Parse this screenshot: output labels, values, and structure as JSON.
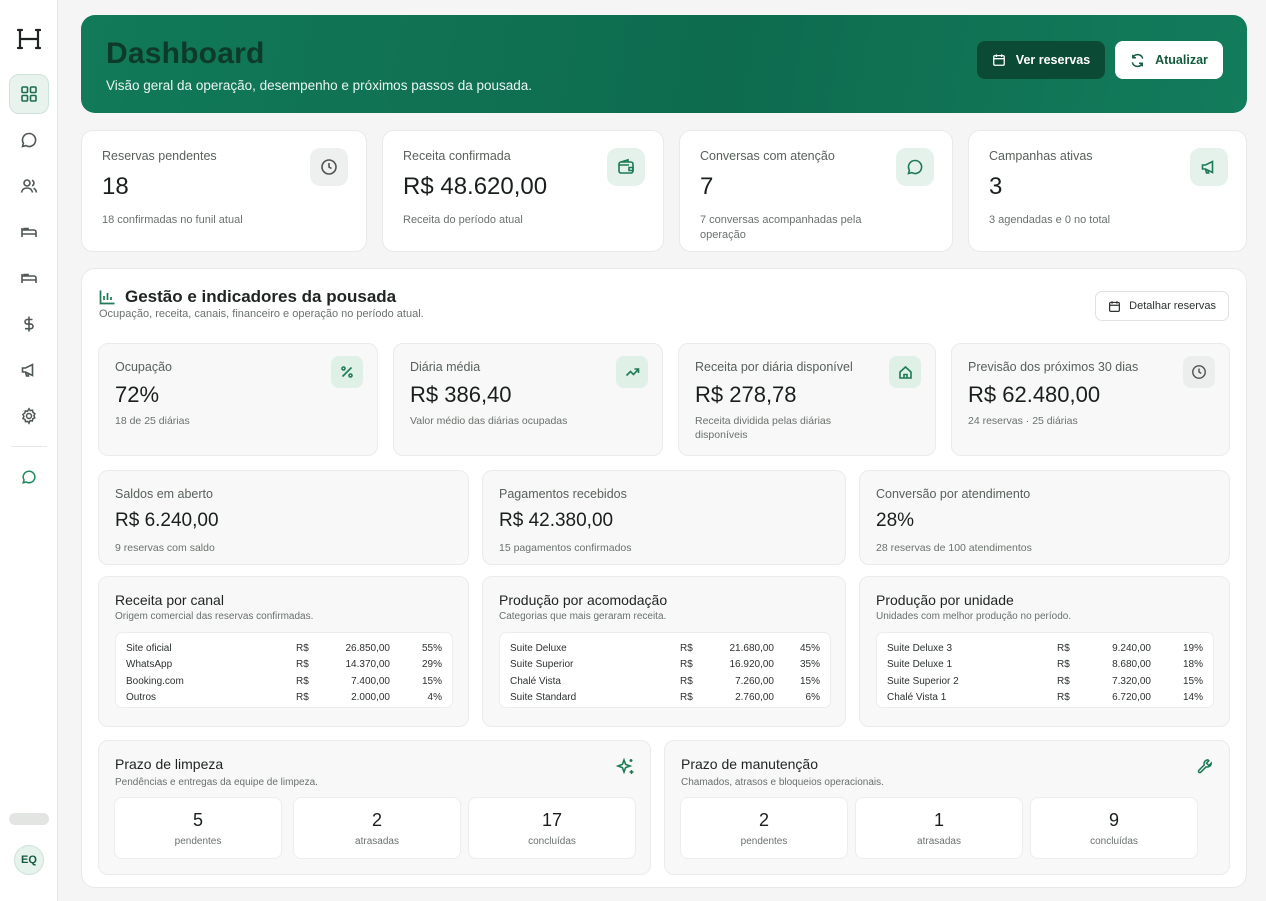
{
  "sidebar": {
    "logo": "H-logo",
    "items": [
      {
        "icon": "grid-icon",
        "active": true
      },
      {
        "icon": "chat-bubble-icon"
      },
      {
        "icon": "users-icon"
      },
      {
        "icon": "bed-icon"
      },
      {
        "icon": "bed-icon"
      },
      {
        "icon": "dollar-icon"
      },
      {
        "icon": "megaphone-icon"
      },
      {
        "icon": "gear-icon"
      },
      {
        "icon": "chat-bubble-icon"
      }
    ],
    "avatar_initials": "EQ"
  },
  "header": {
    "title": "Dashboard",
    "subtitle": "Visão geral da operação, desempenho e próximos passos da pousada.",
    "btn_reservations": "Ver reservas",
    "btn_refresh": "Atualizar"
  },
  "kpis": [
    {
      "label": "Reservas pendentes",
      "value": "18",
      "note": "18 confirmadas no funil atual",
      "icon": "clock-icon"
    },
    {
      "label": "Receita confirmada",
      "value": "R$ 48.620,00",
      "note": "Receita do período atual",
      "icon": "wallet-icon"
    },
    {
      "label": "Conversas com atenção",
      "value": "7",
      "note": "7 conversas acompanhadas pela operação",
      "icon": "chat-bubble-icon"
    },
    {
      "label": "Campanhas ativas",
      "value": "3",
      "note": "3 agendadas e 0 no total",
      "icon": "megaphone-icon"
    }
  ],
  "panel": {
    "title": "Gestão e indicadores da pousada",
    "subtitle": "Ocupação, receita, canais, financeiro e operação no período atual.",
    "btn_details": "Detalhar reservas"
  },
  "metrics": [
    {
      "label": "Ocupação",
      "value": "72%",
      "note": "18 de 25 diárias",
      "icon": "percent-icon"
    },
    {
      "label": "Diária média",
      "value": "R$ 386,40",
      "note": "Valor médio das diárias ocupadas",
      "icon": "trend-up-icon"
    },
    {
      "label": "Receita por diária disponível",
      "value": "R$ 278,78",
      "note": "Receita dividida pelas diárias disponíveis",
      "icon": "home-icon"
    },
    {
      "label": "Previsão dos próximos 30 dias",
      "value": "R$ 62.480,00",
      "note": "24 reservas · 25 diárias",
      "icon": "clock-icon"
    }
  ],
  "finance": [
    {
      "label": "Saldos em aberto",
      "value": "R$ 6.240,00",
      "note": "9 reservas com saldo"
    },
    {
      "label": "Pagamentos recebidos",
      "value": "R$ 42.380,00",
      "note": "15 pagamentos confirmados"
    },
    {
      "label": "Conversão por atendimento",
      "value": "28%",
      "note": "28 reservas de 100 atendimentos"
    }
  ],
  "tables": [
    {
      "title": "Receita por canal",
      "subtitle": "Origem comercial das reservas confirmadas.",
      "rows": [
        {
          "name": "Site oficial",
          "cur": "R$",
          "value": "26.850,00",
          "pct": "55%"
        },
        {
          "name": "WhatsApp",
          "cur": "R$",
          "value": "14.370,00",
          "pct": "29%"
        },
        {
          "name": "Booking.com",
          "cur": "R$",
          "value": "7.400,00",
          "pct": "15%"
        },
        {
          "name": "Outros",
          "cur": "R$",
          "value": "2.000,00",
          "pct": "4%"
        }
      ]
    },
    {
      "title": "Produção por acomodação",
      "subtitle": "Categorias que mais geraram receita.",
      "rows": [
        {
          "name": "Suite Deluxe",
          "cur": "R$",
          "value": "21.680,00",
          "pct": "45%"
        },
        {
          "name": "Suite Superior",
          "cur": "R$",
          "value": "16.920,00",
          "pct": "35%"
        },
        {
          "name": "Chalé Vista",
          "cur": "R$",
          "value": "7.260,00",
          "pct": "15%"
        },
        {
          "name": "Suite Standard",
          "cur": "R$",
          "value": "2.760,00",
          "pct": "6%"
        }
      ]
    },
    {
      "title": "Produção por unidade",
      "subtitle": "Unidades com melhor produção no período.",
      "rows": [
        {
          "name": "Suite Deluxe 3",
          "cur": "R$",
          "value": "9.240,00",
          "pct": "19%"
        },
        {
          "name": "Suite Deluxe 1",
          "cur": "R$",
          "value": "8.680,00",
          "pct": "18%"
        },
        {
          "name": "Suite Superior 2",
          "cur": "R$",
          "value": "7.320,00",
          "pct": "15%"
        },
        {
          "name": "Chalé Vista 1",
          "cur": "R$",
          "value": "6.720,00",
          "pct": "14%"
        }
      ]
    }
  ],
  "cleaning": {
    "title": "Prazo de limpeza",
    "subtitle": "Pendências e entregas da equipe de limpeza.",
    "icon": "sparkles-icon",
    "stats": [
      {
        "value": "5",
        "label": "pendentes"
      },
      {
        "value": "2",
        "label": "atrasadas"
      },
      {
        "value": "17",
        "label": "concluídas"
      }
    ]
  },
  "maintenance": {
    "title": "Prazo de manutenção",
    "subtitle": "Chamados, atrasos e bloqueios operacionais.",
    "icon": "wrench-icon",
    "stats": [
      {
        "value": "2",
        "label": "pendentes"
      },
      {
        "value": "1",
        "label": "atrasadas"
      },
      {
        "value": "9",
        "label": "concluídas"
      }
    ]
  }
}
